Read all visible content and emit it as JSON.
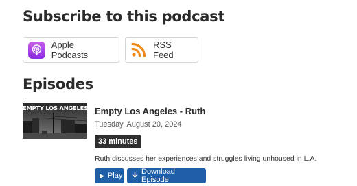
{
  "subscribe": {
    "title": "Subscribe to this podcast",
    "apple_label": "Apple Podcasts",
    "rss_label": "RSS Feed"
  },
  "episodes": {
    "title": "Episodes",
    "items": [
      {
        "thumbnail_text": "EMPTY LOS ANGELES",
        "title": "Empty Los Angeles - Ruth",
        "date": "Tuesday, August 20, 2024",
        "duration": "33 minutes",
        "description": "Ruth discusses her experiences and struggles living unhoused in L.A.",
        "play_label": "Play",
        "download_label": "Download Episode"
      }
    ]
  },
  "icons": {
    "apple": "apple-podcasts-icon",
    "rss": "rss-feed-icon",
    "play": "play-icon",
    "download": "download-icon"
  },
  "colors": {
    "accent": "#1f5fa8",
    "apple_purple": "#a742d8",
    "rss_orange": "#f08a18",
    "duration_badge": "#2f2f2f"
  }
}
